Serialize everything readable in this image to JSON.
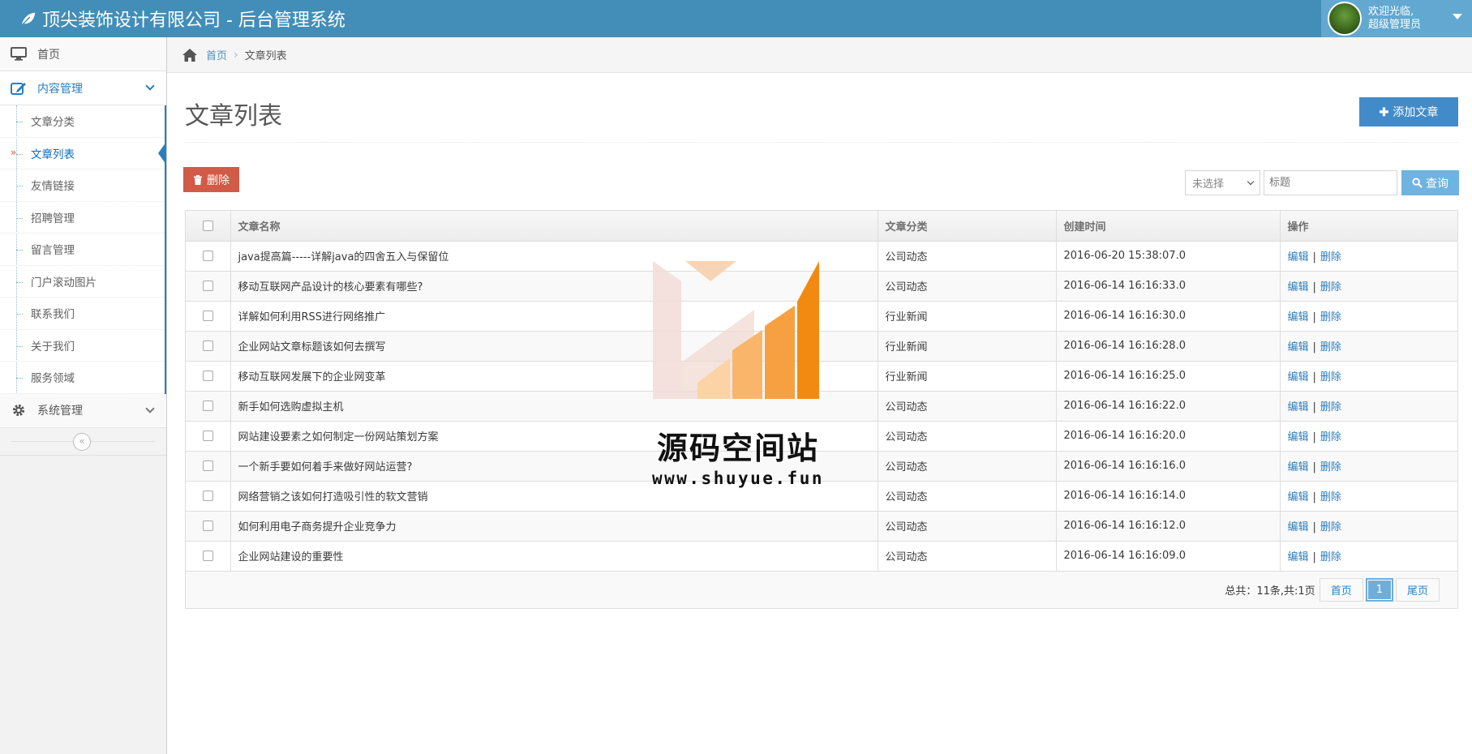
{
  "header": {
    "title": "顶尖装饰设计有限公司 - 后台管理系统",
    "welcome": "欢迎光临,",
    "user_role": "超级管理员"
  },
  "sidebar": {
    "home": "首页",
    "content_group": "内容管理",
    "content_items": [
      "文章分类",
      "文章列表",
      "友情链接",
      "招聘管理",
      "留言管理",
      "门户滚动图片",
      "联系我们",
      "关于我们",
      "服务领域"
    ],
    "active_item": "文章列表",
    "system_group": "系统管理",
    "collapse_glyph": "«"
  },
  "breadcrumb": {
    "home": "首页",
    "current": "文章列表"
  },
  "page": {
    "title": "文章列表",
    "add_button": "添加文章",
    "delete_button": "删除"
  },
  "search": {
    "category_selected": "未选择",
    "title_placeholder": "标题",
    "query_button": "查询"
  },
  "table": {
    "columns": [
      "文章名称",
      "文章分类",
      "创建时间",
      "操作"
    ],
    "rows": [
      {
        "name": "java提高篇-----详解java的四舍五入与保留位",
        "category": "公司动态",
        "created": "2016-06-20 15:38:07.0"
      },
      {
        "name": "移动互联网产品设计的核心要素有哪些?",
        "category": "公司动态",
        "created": "2016-06-14 16:16:33.0"
      },
      {
        "name": "详解如何利用RSS进行网络推广",
        "category": "行业新闻",
        "created": "2016-06-14 16:16:30.0"
      },
      {
        "name": "企业网站文章标题该如何去撰写",
        "category": "行业新闻",
        "created": "2016-06-14 16:16:28.0"
      },
      {
        "name": "移动互联网发展下的企业网变革",
        "category": "行业新闻",
        "created": "2016-06-14 16:16:25.0"
      },
      {
        "name": "新手如何选购虚拟主机",
        "category": "公司动态",
        "created": "2016-06-14 16:16:22.0"
      },
      {
        "name": "网站建设要素之如何制定一份网站策划方案",
        "category": "公司动态",
        "created": "2016-06-14 16:16:20.0"
      },
      {
        "name": "一个新手要如何着手来做好网站运营?",
        "category": "公司动态",
        "created": "2016-06-14 16:16:16.0"
      },
      {
        "name": "网络营销之该如何打造吸引性的软文营销",
        "category": "公司动态",
        "created": "2016-06-14 16:16:14.0"
      },
      {
        "name": "如何利用电子商务提升企业竞争力",
        "category": "公司动态",
        "created": "2016-06-14 16:16:12.0"
      },
      {
        "name": "企业网站建设的重要性",
        "category": "公司动态",
        "created": "2016-06-14 16:16:09.0"
      }
    ],
    "edit_label": "编辑",
    "delete_label": "删除",
    "op_separator": "|"
  },
  "pager": {
    "total": "总共：11条,共:1页",
    "first": "首页",
    "current": "1",
    "last": "尾页"
  },
  "watermark": {
    "text": "源码空间站",
    "url": "www.shuyue.fun"
  },
  "colors": {
    "header": "#438eb9",
    "primary": "#428bca",
    "danger": "#d15b47",
    "link": "#2b7dbc"
  }
}
